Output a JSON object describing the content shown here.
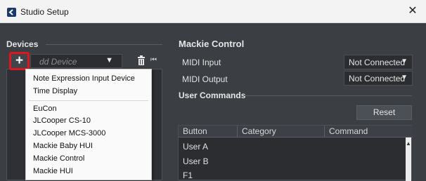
{
  "window": {
    "title": "Studio Setup",
    "close_glyph": "✕"
  },
  "devices": {
    "label": "Devices",
    "add_glyph": "+",
    "add_placeholder": "dd Device",
    "dropdown_glyph": "▼",
    "delete_icon": "trash-icon",
    "skip_glyph": "⏮",
    "menu_items": [
      "Note Expression Input Device",
      "Time Display",
      "EuCon",
      "JLCooper CS-10",
      "JLCooper MCS-3000",
      "Mackie Baby HUI",
      "Mackie Control",
      "Mackie HUI"
    ]
  },
  "mackie": {
    "title": "Mackie Control",
    "midi_input_label": "MIDI Input",
    "midi_input_value": "Not Connected",
    "midi_output_label": "MIDI Output",
    "midi_output_value": "Not Connected",
    "dropdown_glyph": "▼"
  },
  "user_commands": {
    "label": "User Commands",
    "reset_label": "Reset",
    "columns": [
      "Button",
      "Category",
      "Command"
    ],
    "rows": [
      "User A",
      "User B",
      "F1"
    ],
    "scroll_up_glyph": "▲"
  },
  "colors": {
    "accent_highlight": "#e0161e",
    "app_icon": "#1b3a6b"
  }
}
